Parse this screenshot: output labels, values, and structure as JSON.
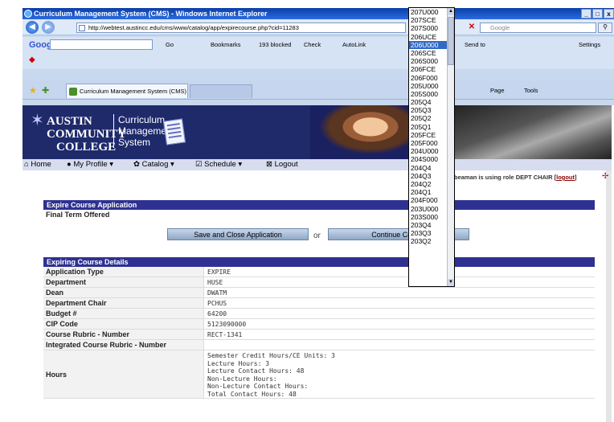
{
  "window": {
    "title": "Curriculum Management System (CMS) - Windows Internet Explorer",
    "buttons": [
      "_",
      "□",
      "x"
    ]
  },
  "browser": {
    "url": "http://webtest.austincc.edu/cms/www/catalog/app/expirecourse.php?cid=11283",
    "search_placeholder": "Google",
    "tab_title": "Curriculum Management System (CMS)",
    "google_label": "Google",
    "toolbar": {
      "go": "Go",
      "bookmarks": "Bookmarks",
      "blocked": "193 blocked",
      "check": "Check",
      "autolink": "AutoLink",
      "sendto": "Send to",
      "settings": "Settings"
    },
    "command": {
      "page": "Page",
      "tools": "Tools"
    }
  },
  "site": {
    "logo_line1": "AUSTIN",
    "logo_line2": "COMMUNITY",
    "logo_line3": "COLLEGE",
    "cms_line1": "Curriculum",
    "cms_line2": "Management",
    "cms_line3": "System"
  },
  "menu": {
    "home": "Home",
    "profile": "My Profile",
    "catalog": "Catalog",
    "schedule": "Schedule",
    "logout": "Logout"
  },
  "role": {
    "text": "beaman is using role DEPT CHAIR [",
    "logout": "logout",
    "close": "]"
  },
  "expire_app": {
    "header": "Expire Course Application",
    "final_term_label": "Final Term Offered",
    "save_close": "Save and Close Application",
    "or": "or",
    "continue": "Continue Course"
  },
  "details": {
    "header": "Expiring Course Details",
    "rows": [
      {
        "label": "Application Type",
        "value": "EXPIRE"
      },
      {
        "label": "Department",
        "value": "HUSE"
      },
      {
        "label": "Dean",
        "value": "DWATM"
      },
      {
        "label": "Department Chair",
        "value": "PCHUS"
      },
      {
        "label": "Budget #",
        "value": "64200"
      },
      {
        "label": "CIP Code",
        "value": "5123090000"
      },
      {
        "label": "Course Rubric - Number",
        "value": "RECT-1341"
      },
      {
        "label": "Integrated Course Rubric - Number",
        "value": ""
      }
    ],
    "hours_label": "Hours",
    "hours_lines": [
      "Semester Credit Hours/CE Units: 3",
      "Lecture Hours: 3",
      "Lecture Contact Hours: 48",
      "Non-Lecture Hours:",
      "Non-Lecture Contact Hours:",
      "Total Contact Hours: 48"
    ]
  },
  "term_dropdown": {
    "selected": "206U000",
    "options": [
      "207U000",
      "207SCE",
      "207S000",
      "206UCE",
      "206U000",
      "206SCE",
      "206S000",
      "206FCE",
      "206F000",
      "205U000",
      "205S000",
      "205Q4",
      "205Q3",
      "205Q2",
      "205Q1",
      "205FCE",
      "205F000",
      "204U000",
      "204S000",
      "204Q4",
      "204Q3",
      "204Q2",
      "204Q1",
      "204F000",
      "203U000",
      "203S000",
      "203Q4",
      "203Q3",
      "203Q2"
    ]
  }
}
